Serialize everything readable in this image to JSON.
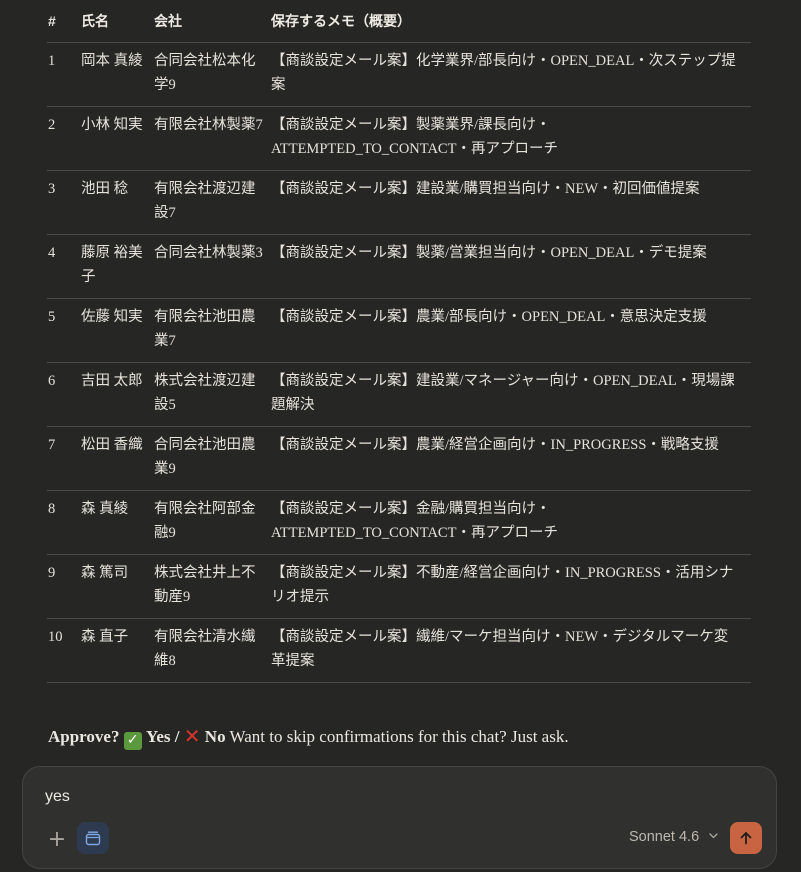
{
  "table": {
    "headers": [
      "#",
      "氏名",
      "会社",
      "保存するメモ（概要）"
    ],
    "rows": [
      {
        "num": "1",
        "name": "岡本 真綾",
        "company": "合同会社松本化学9",
        "memo": "【商談設定メール案】化学業界/部長向け・OPEN_DEAL・次ステップ提案"
      },
      {
        "num": "2",
        "name": "小林 知実",
        "company": "有限会社林製薬7",
        "memo": "【商談設定メール案】製薬業界/課長向け・ATTEMPTED_TO_CONTACT・再アプローチ"
      },
      {
        "num": "3",
        "name": "池田 稔",
        "company": "有限会社渡辺建設7",
        "memo": "【商談設定メール案】建設業/購買担当向け・NEW・初回価値提案"
      },
      {
        "num": "4",
        "name": "藤原 裕美子",
        "company": "合同会社林製薬3",
        "memo": "【商談設定メール案】製薬/営業担当向け・OPEN_DEAL・デモ提案"
      },
      {
        "num": "5",
        "name": "佐藤 知実",
        "company": "有限会社池田農業7",
        "memo": "【商談設定メール案】農業/部長向け・OPEN_DEAL・意思決定支援"
      },
      {
        "num": "6",
        "name": "吉田 太郎",
        "company": "株式会社渡辺建設5",
        "memo": "【商談設定メール案】建設業/マネージャー向け・OPEN_DEAL・現場課題解決"
      },
      {
        "num": "7",
        "name": "松田 香織",
        "company": "合同会社池田農業9",
        "memo": "【商談設定メール案】農業/経営企画向け・IN_PROGRESS・戦略支援"
      },
      {
        "num": "8",
        "name": "森 真綾",
        "company": "有限会社阿部金融9",
        "memo": "【商談設定メール案】金融/購買担当向け・ATTEMPTED_TO_CONTACT・再アプローチ"
      },
      {
        "num": "9",
        "name": "森 篤司",
        "company": "株式会社井上不動産9",
        "memo": "【商談設定メール案】不動産/経営企画向け・IN_PROGRESS・活用シナリオ提示"
      },
      {
        "num": "10",
        "name": "森 直子",
        "company": "有限会社清水繊維8",
        "memo": "【商談設定メール案】繊維/マーケ担当向け・NEW・デジタルマーケ変革提案"
      }
    ]
  },
  "approval": {
    "question": "Approve?",
    "yes_label": "Yes",
    "separator": "/",
    "no_label": "No",
    "hint": "Want to skip confirmations for this chat? Just ask."
  },
  "composer": {
    "text": "yes",
    "model_label": "Sonnet 4.6"
  },
  "icons": {
    "check": "check-mark-icon",
    "cross": "cross-mark-icon",
    "plus": "plus-icon",
    "tools": "tools-icon",
    "chevron": "chevron-down-icon",
    "send": "arrow-up-icon"
  },
  "colors": {
    "background": "#262624",
    "composer_bg": "#30302e",
    "send_button": "#c96442",
    "tools_button": "#2e3a4f"
  }
}
